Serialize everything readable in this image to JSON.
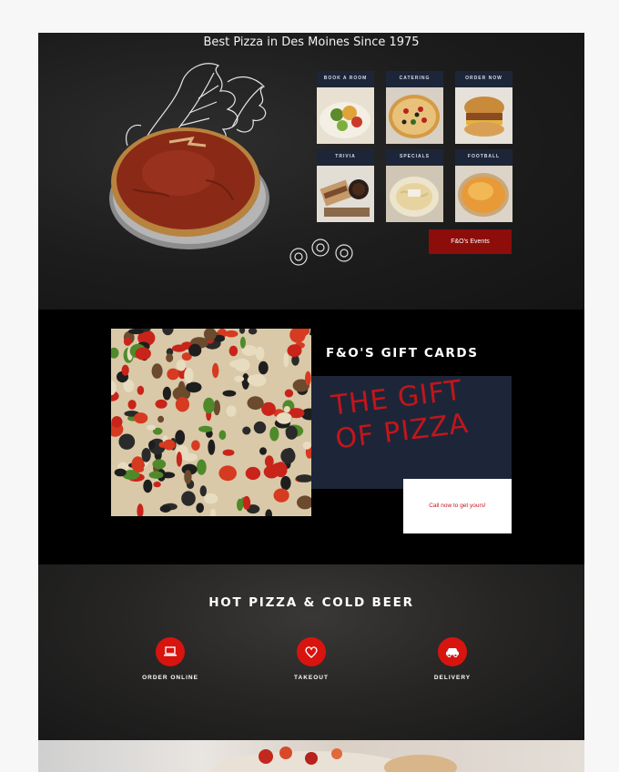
{
  "hero": {
    "tagline": "Best Pizza in Des Moines Since 1975",
    "tiles": [
      {
        "label": "Book a Room"
      },
      {
        "label": "Catering"
      },
      {
        "label": "Order Now"
      },
      {
        "label": "Trivia"
      },
      {
        "label": "Specials"
      },
      {
        "label": "Football"
      }
    ],
    "events_button": "F&O's Events"
  },
  "gift": {
    "title": "F&O'S GIFT CARDS",
    "script_line1": "THE GIFT",
    "script_line2": "OF PIZZA",
    "cta": "Call now to get yours!"
  },
  "hot": {
    "title": "HOT PIZZA & COLD BEER",
    "features": [
      {
        "label": "ORDER ONLINE",
        "icon": "laptop-icon"
      },
      {
        "label": "TAKEOUT",
        "icon": "heart-icon"
      },
      {
        "label": "DELIVERY",
        "icon": "car-icon"
      }
    ]
  },
  "colors": {
    "accent_red": "#d8140f",
    "dark_red": "#8c0d0a",
    "navy": "#1d2638",
    "script_red": "#c2161b"
  }
}
